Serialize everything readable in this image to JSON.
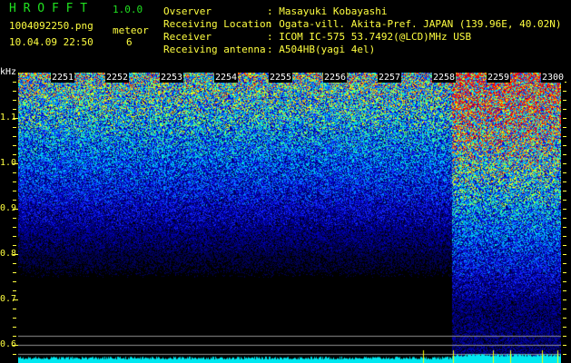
{
  "app": {
    "title": "H R O F F T",
    "version": "1.0.0"
  },
  "file": {
    "name": "1004092250.png",
    "datetime": "10.04.09 22:50"
  },
  "meteor": {
    "label": "meteor",
    "count": "6"
  },
  "info": [
    {
      "label": "Ovserver",
      "value": ": Masayuki Kobayashi"
    },
    {
      "label": "Receiving Location",
      "value": ": Ogata-vill. Akita-Pref. JAPAN (139.96E, 40.02N)"
    },
    {
      "label": "Receiver",
      "value": ": ICOM IC-575 53.7492(@LCD)MHz USB"
    },
    {
      "label": "Receiving antenna",
      "value": ": A504HB(yagi 4el)"
    }
  ],
  "axis": {
    "unit": "kHz",
    "freq_labels": [
      "1.1",
      "1.0",
      "0.9",
      "0.8",
      "0.7",
      "0.6"
    ],
    "time_labels": [
      "2251",
      "2252",
      "2253",
      "2254",
      "2255",
      "2256",
      "2257",
      "2258",
      "2259",
      "2300"
    ]
  },
  "colors": {
    "text": "#ffff40",
    "title": "#20e020",
    "level": "#00e8f0"
  }
}
